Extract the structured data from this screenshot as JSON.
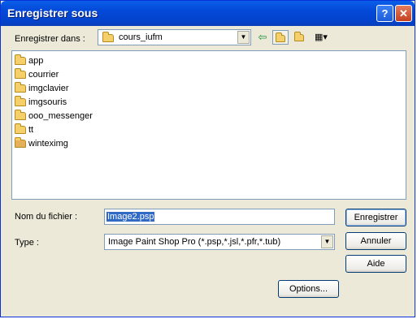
{
  "window": {
    "title": "Enregistrer sous",
    "help_label": "?",
    "close_label": "✕"
  },
  "save_in": {
    "label": "Enregistrer dans :",
    "value": "cours_iufm"
  },
  "files": [
    {
      "name": "app"
    },
    {
      "name": "courrier"
    },
    {
      "name": "imgclavier"
    },
    {
      "name": "imgsouris"
    },
    {
      "name": "ooo_messenger"
    },
    {
      "name": "tt"
    },
    {
      "name": "winteximg"
    }
  ],
  "filename": {
    "label": "Nom du fichier :",
    "value": "Image2.psp"
  },
  "filetype": {
    "label": "Type :",
    "value": "Image Paint Shop Pro (*.psp,*.jsl,*.pfr,*.tub)"
  },
  "buttons": {
    "save": "Enregistrer",
    "cancel": "Annuler",
    "help": "Aide",
    "options": "Options..."
  },
  "icons": {
    "back": "back-arrow-icon",
    "up": "up-folder-icon",
    "new_folder": "new-folder-icon",
    "view": "view-menu-icon"
  }
}
